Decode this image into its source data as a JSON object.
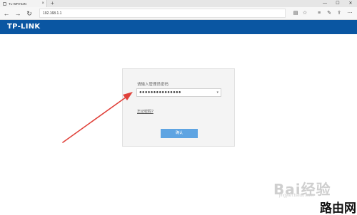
{
  "browser": {
    "tab_title": "TL-WR742N",
    "tab_close": "×",
    "new_tab": "+",
    "address": "192.168.1.1",
    "back_glyph": "←",
    "forward_glyph": "→",
    "refresh_glyph": "↻",
    "window_controls": [
      "—",
      "☐",
      "✕"
    ],
    "toolbar_icons": [
      "reading-view-icon",
      "favorite-star-icon",
      "hub-icon",
      "web-note-icon",
      "share-icon",
      "more-icon"
    ]
  },
  "brand": {
    "logo": "TP-LINK",
    "color": "#0a56a2"
  },
  "login": {
    "prompt": "请输入管理员密码",
    "password_value": "●●●●●●●●●●●●●●●",
    "forgot_link": "忘记密码?",
    "confirm_label": "确认",
    "button_color": "#5ea4e2"
  },
  "annotation": {
    "arrow_color": "#e0413a"
  },
  "watermark": {
    "baidu": "Bai经验",
    "jingyan": "jingyan.baidu.com",
    "site": "路由网"
  }
}
